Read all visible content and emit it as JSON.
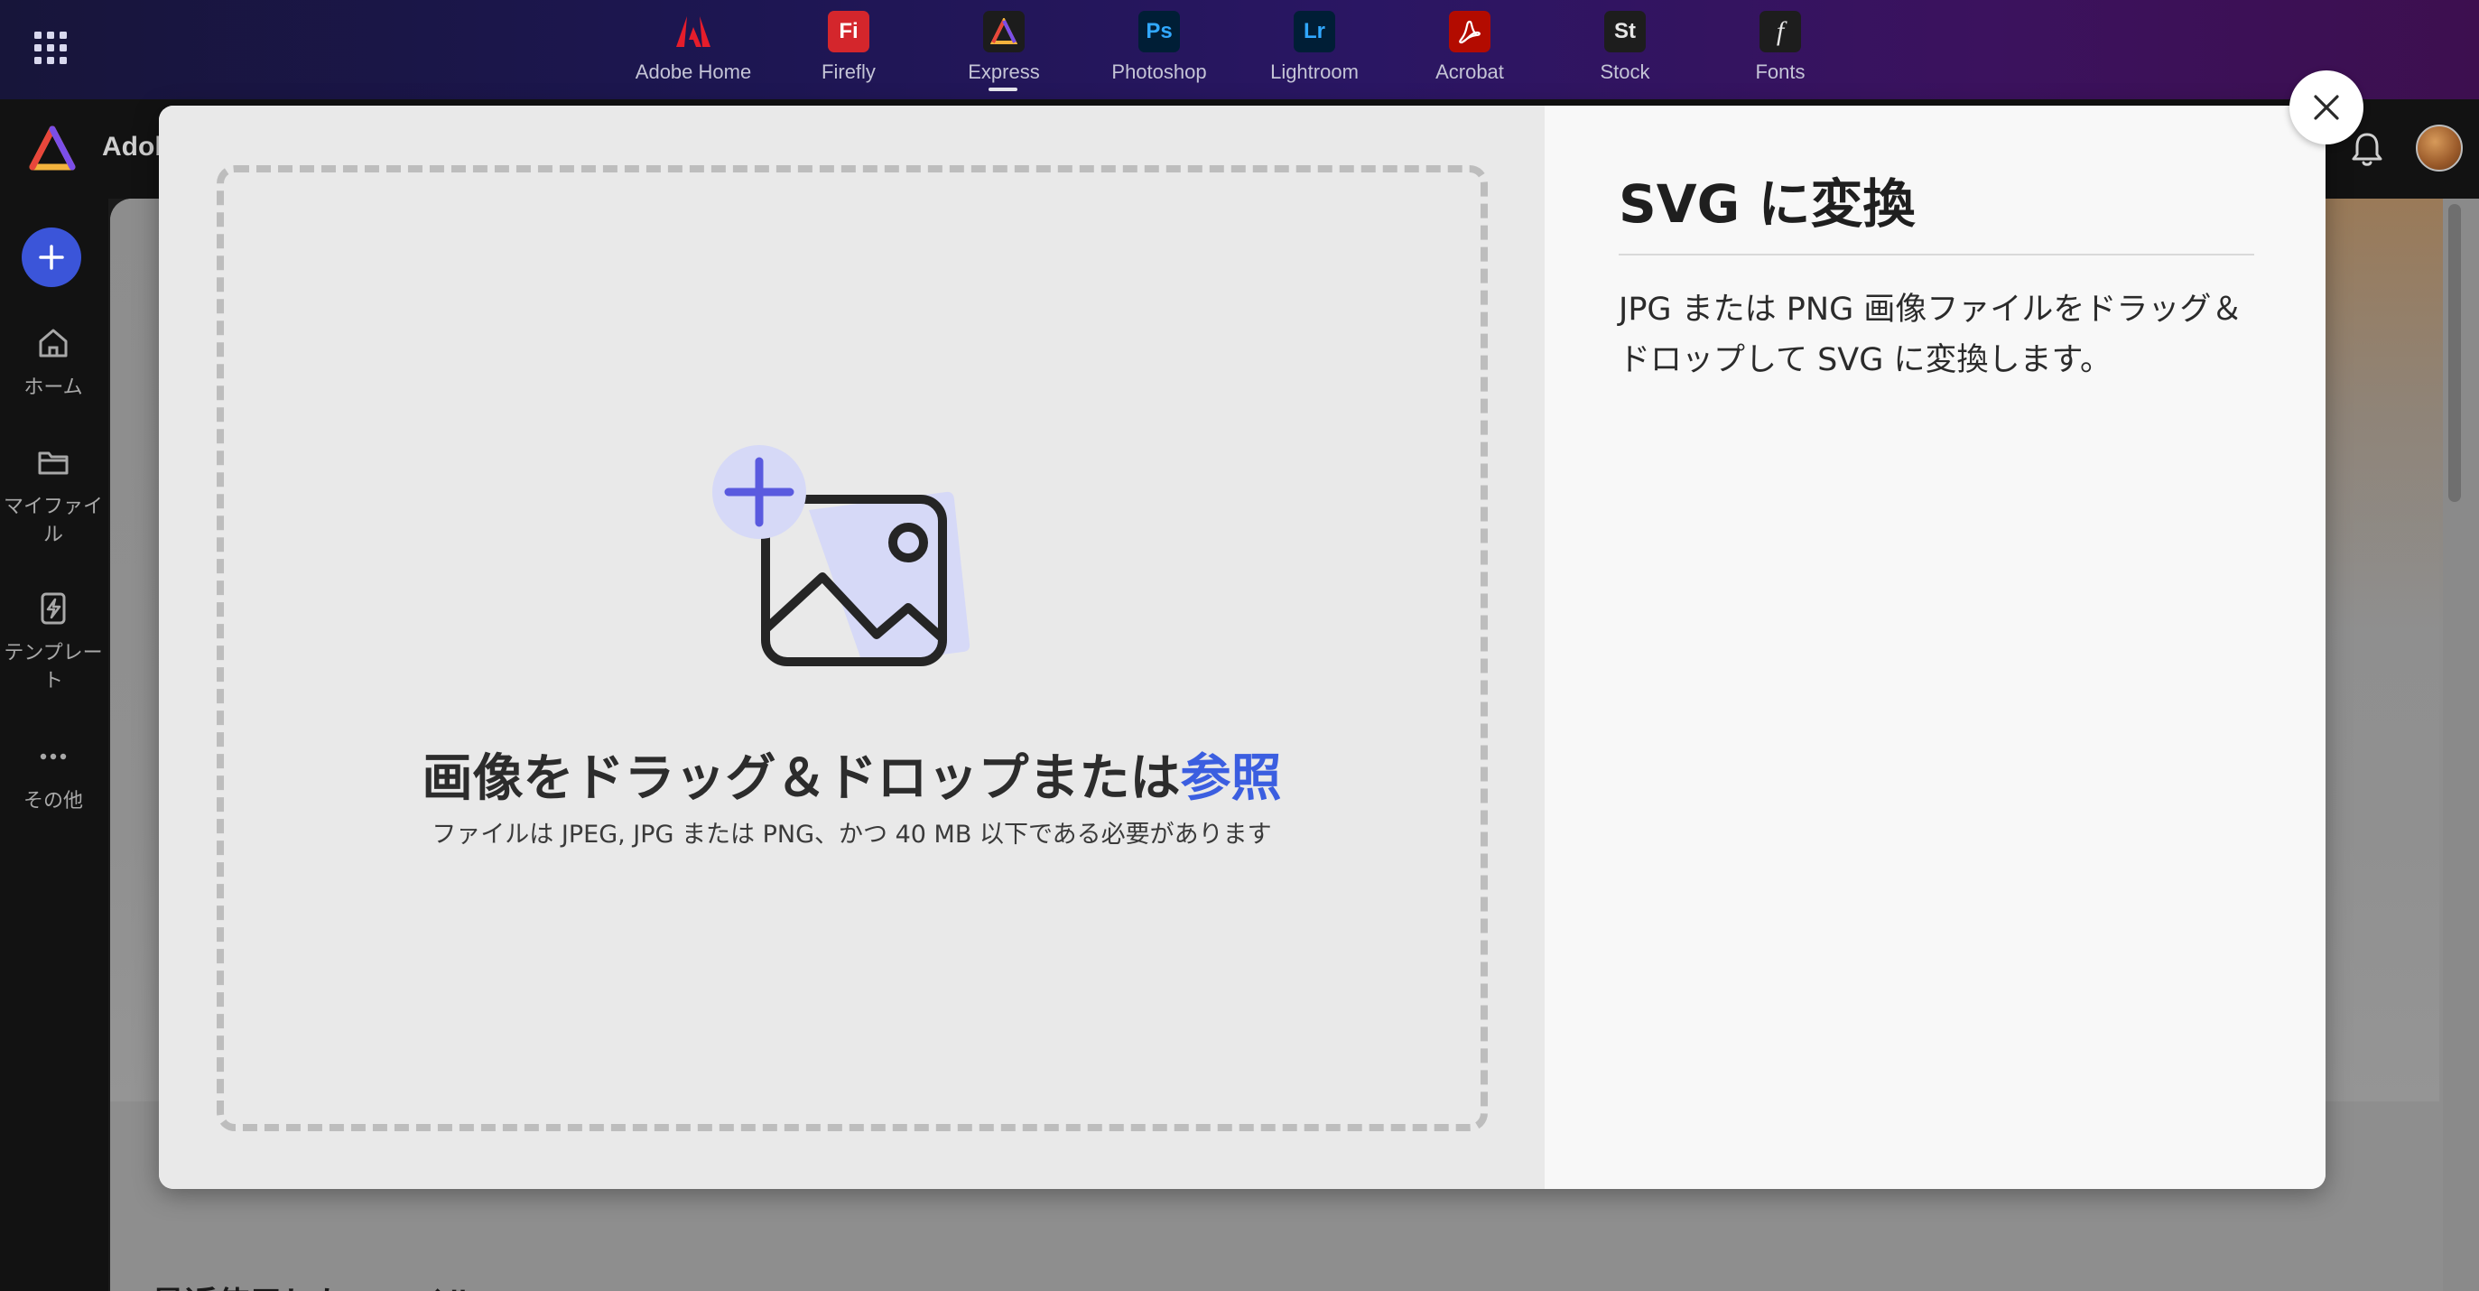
{
  "app_switcher": {
    "apps": [
      {
        "name": "Adobe Home",
        "tile_text": "",
        "icon": "adobe-logo-icon",
        "bg": "#2b0b12",
        "fg": "#e61d2b",
        "active": false
      },
      {
        "name": "Firefly",
        "tile_text": "Fi",
        "icon": "firefly-icon",
        "bg": "#d4262c",
        "fg": "#ffffff",
        "active": false
      },
      {
        "name": "Express",
        "tile_text": "",
        "icon": "express-icon",
        "bg": "#1c1c1c",
        "fg": "#ffffff",
        "active": true
      },
      {
        "name": "Photoshop",
        "tile_text": "Ps",
        "icon": "photoshop-icon",
        "bg": "#001e36",
        "fg": "#31a8ff",
        "active": false
      },
      {
        "name": "Lightroom",
        "tile_text": "Lr",
        "icon": "lightroom-icon",
        "bg": "#001e36",
        "fg": "#31a8ff",
        "active": false
      },
      {
        "name": "Acrobat",
        "tile_text": "",
        "icon": "acrobat-icon",
        "bg": "#b30b00",
        "fg": "#ffffff",
        "active": false
      },
      {
        "name": "Stock",
        "tile_text": "St",
        "icon": "stock-icon",
        "bg": "#1d1d1d",
        "fg": "#e6e6e6",
        "active": false
      },
      {
        "name": "Fonts",
        "tile_text": "f",
        "icon": "fonts-icon",
        "bg": "#1d1d1d",
        "fg": "#e6e6e6",
        "active": false
      }
    ]
  },
  "header": {
    "brand_partial": "Adob"
  },
  "sidebar": {
    "create_icon": "plus-icon",
    "items": [
      {
        "label": "ホーム",
        "icon": "home-icon"
      },
      {
        "label": "マイファイル",
        "icon": "folder-icon"
      },
      {
        "label": "テンプレート",
        "icon": "template-icon"
      },
      {
        "label": "その他",
        "icon": "more-icon"
      }
    ]
  },
  "page": {
    "recent_heading": "最近使用したファイル"
  },
  "modal": {
    "title": "SVG に変換",
    "description": "JPG または PNG 画像ファイルをドラッグ＆ドロップして SVG に変換します。",
    "dropzone": {
      "title": "画像をドラッグ＆ドロップまたは",
      "browse_label": "参照",
      "subtitle": "ファイルは JPEG, JPG または PNG、かつ 40 MB 以下である必要があります"
    },
    "close_icon": "close-icon"
  },
  "colors": {
    "accent": "#3b5ee0",
    "create_button": "#3b55d9",
    "illustration_plus": "#5a5adf"
  }
}
